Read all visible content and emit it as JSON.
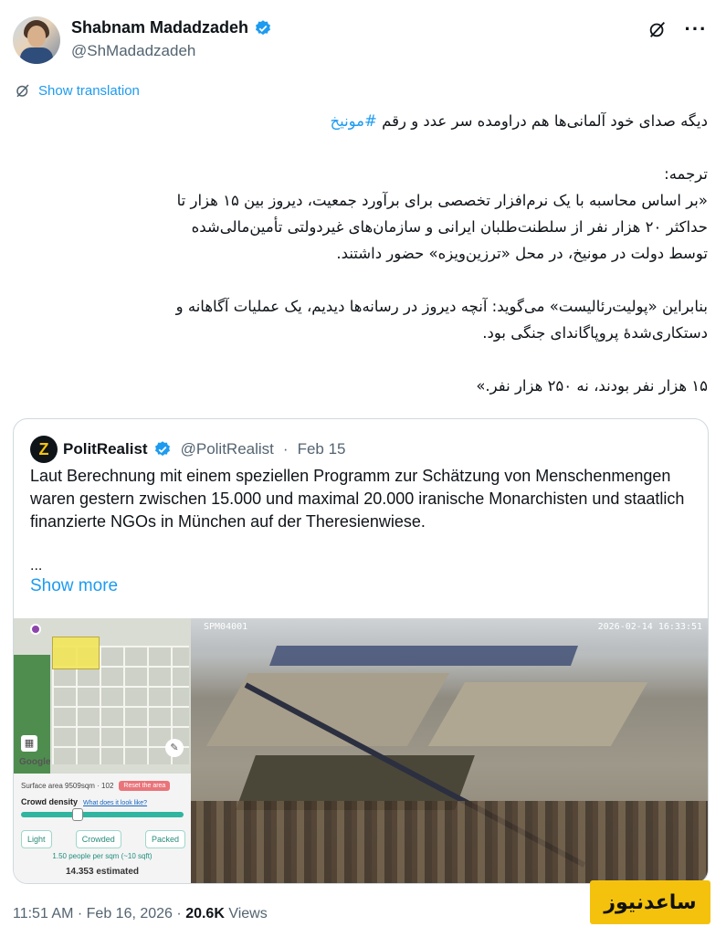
{
  "author": {
    "name": "Shabnam Madadzadeh",
    "handle": "@ShMadadzadeh"
  },
  "header_icons": [
    "grok-icon",
    "more-options-icon"
  ],
  "translate_label": "Show translation",
  "tweet": {
    "line1_text": "دیگه صدای خود آلمانی‌ها هم دراومده سر عدد و رقم",
    "line1_hashtag": "#مونیخ",
    "line2": "ترجمه:",
    "line3": "«بر اساس محاسبه با یک نرم‌افزار تخصصی برای برآورد جمعیت، دیروز بین ۱۵ هزار تا",
    "line4": "حداکثر ۲۰ هزار نفر از سلطنت‌طلبان ایرانی و سازمان‌های غیردولتی تأمین‌مالی‌شده",
    "line5": "توسط دولت در مونیخ، در محل «ترزین‌ویزه» حضور داشتند.",
    "line6": "بنابراین «پولیت‌رئالیست» می‌گوید: آنچه دیروز در رسانه‌ها دیدیم، یک عملیات آگاهانه و",
    "line7": "دستکاری‌شدهٔ پروپاگاندای جنگی بود.",
    "line8": "۱۵ هزار نفر بودند، نه ۲۵۰ هزار نفر.»"
  },
  "quote": {
    "name": "PolitRealist",
    "handle": "@PolitRealist",
    "separator": "·",
    "date": "Feb 15",
    "body": "Laut Berechnung mit einem speziellen Programm zur Schätzung von Menschenmengen waren gestern zwischen 15.000 und maximal 20.000 iranische Monarchisten und staatlich finanzierte NGOs in München auf der Theresienwiese.",
    "ellipsis": "...",
    "show_more": "Show more",
    "app": {
      "google": "Google",
      "surface": "Surface area 9509sqm · 102",
      "reset": "Reset the area",
      "density_label": "Crowd density",
      "density_link": "What does it look like?",
      "density_level": 0.35,
      "btn_light": "Light",
      "btn_crowded": "Crowded",
      "btn_packed": "Packed",
      "per_sqm": "1.50 people per sqm (~10 sqft)",
      "estimated": "14.353 estimated"
    },
    "photo": {
      "stamp_left": "SPM04001",
      "stamp_right": "2026-02-14 16:33:51"
    }
  },
  "watermark": "ساعدنیوز",
  "meta": {
    "time": "11:51 AM",
    "separator": "·",
    "date": "Feb 16, 2026",
    "views_count": "20.6K",
    "views_label": "Views"
  }
}
